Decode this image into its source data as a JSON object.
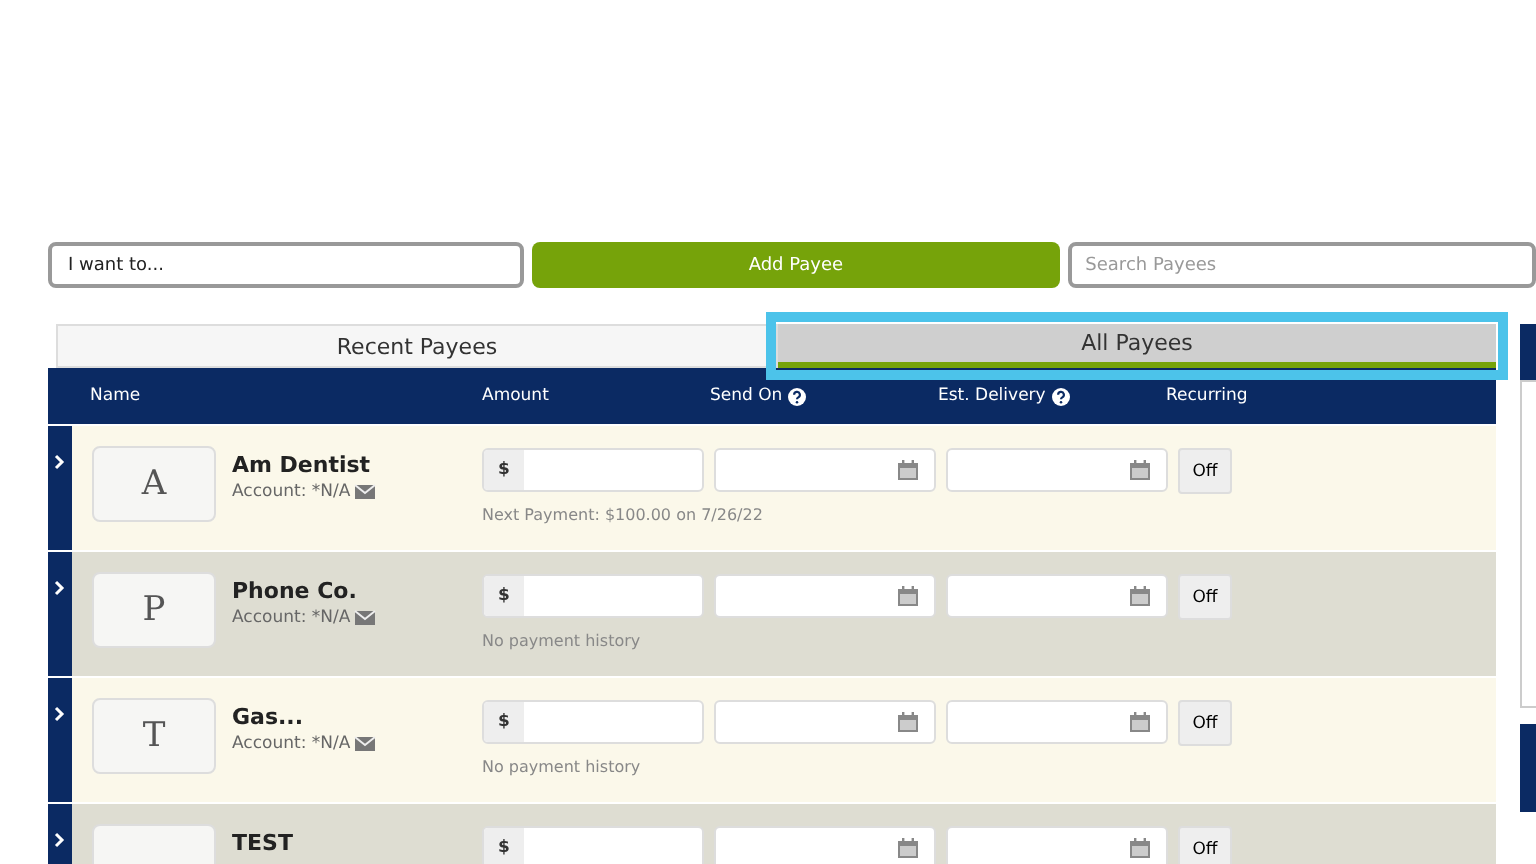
{
  "toolbar": {
    "action_select": "I want to...",
    "add_button": "Add Payee",
    "search": {
      "placeholder": "Search Payees"
    }
  },
  "tabs": [
    {
      "label": "Recent Payees",
      "selected": false
    },
    {
      "label": "All Payees",
      "selected": true
    }
  ],
  "columns": [
    {
      "label": "Name",
      "help": false
    },
    {
      "label": "Amount",
      "help": false
    },
    {
      "label": "Send On",
      "help": true
    },
    {
      "label": "Est. Delivery",
      "help": true
    },
    {
      "label": "Recurring",
      "help": false
    }
  ],
  "payees": [
    {
      "initial": "A",
      "name": "Am Dentist",
      "account": "Account: *N/A",
      "currency": "$",
      "note": "Next Payment: $100.00 on 7/26/22",
      "recurring": "Off"
    },
    {
      "initial": "P",
      "name": "Phone Co.",
      "account": "Account: *N/A",
      "currency": "$",
      "note": "No payment history",
      "recurring": "Off"
    },
    {
      "initial": "T",
      "name": "Gas...",
      "account": "Account: *N/A",
      "currency": "$",
      "note": "No payment history",
      "recurring": "Off"
    },
    {
      "name": "TEST",
      "currency": "$",
      "recurring": "Off"
    }
  ]
}
